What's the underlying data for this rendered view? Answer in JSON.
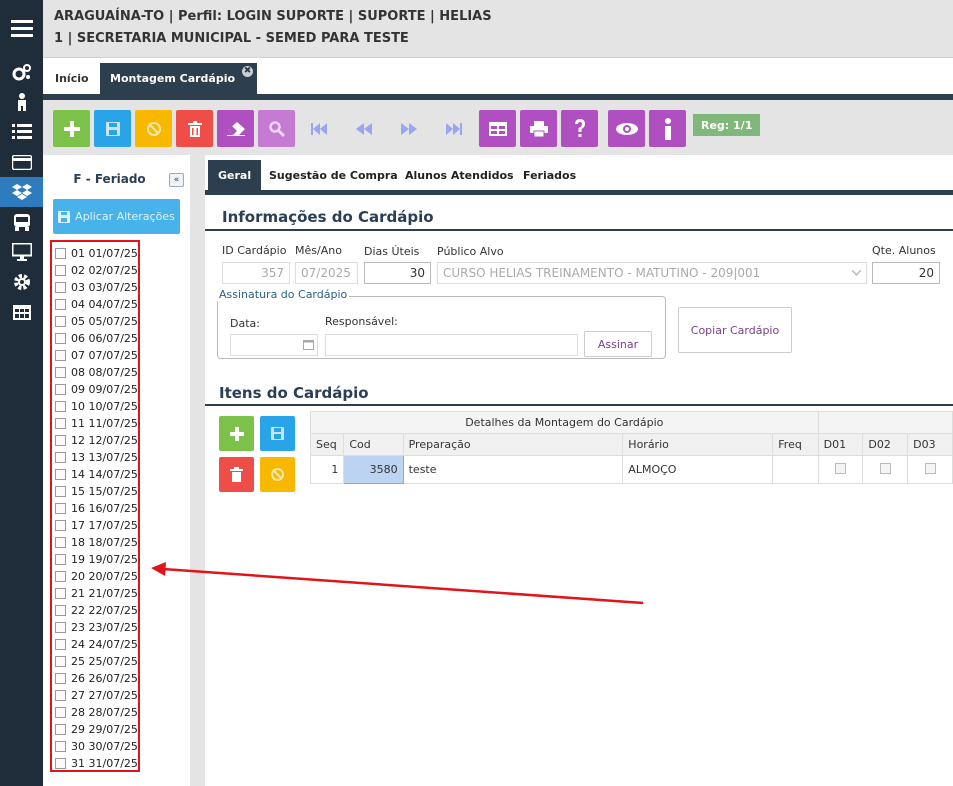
{
  "header": {
    "line1": "ARAGUAÍNA-TO | Perfil: LOGIN SUPORTE | SUPORTE | HELIAS",
    "line2": "1 | SECRETARIA MUNICIPAL - SEMED PARA TESTE"
  },
  "sidebar_icons": [
    "menu-icon",
    "cogs-icon",
    "person-icon",
    "list-icon",
    "credit-card-icon",
    "dropbox-icon",
    "bus-icon",
    "desktop-icon",
    "gear-icon",
    "table-icon"
  ],
  "tabs": [
    {
      "label": "Início"
    },
    {
      "label": "Montagem Cardápio",
      "close": "✖"
    }
  ],
  "toolbar": {
    "reg_label": "Reg: 1/1"
  },
  "left_panel": {
    "title": "F - Feriado",
    "collapse": "«",
    "apply_label": "Aplicar Alterações",
    "days": [
      "01 01/07/25",
      "02 02/07/25",
      "03 03/07/25",
      "04 04/07/25",
      "05 05/07/25",
      "06 06/07/25",
      "07 07/07/25",
      "08 08/07/25",
      "09 09/07/25",
      "10 10/07/25",
      "11 11/07/25",
      "12 12/07/25",
      "13 13/07/25",
      "14 14/07/25",
      "15 15/07/25",
      "16 16/07/25",
      "17 17/07/25",
      "18 18/07/25",
      "19 19/07/25",
      "20 20/07/25",
      "21 21/07/25",
      "22 22/07/25",
      "23 23/07/25",
      "24 24/07/25",
      "25 25/07/25",
      "26 26/07/25",
      "27 27/07/25",
      "28 28/07/25",
      "29 29/07/25",
      "30 30/07/25",
      "31 31/07/25"
    ]
  },
  "subtabs": [
    "Geral",
    "Sugestão de Compra",
    "Alunos Atendidos",
    "Feriados"
  ],
  "info": {
    "section_title": "Informações do Cardápio",
    "id_label": "ID Cardápio",
    "id_value": "357",
    "mes_label": "Mês/Ano",
    "mes_value": "07/2025",
    "dias_label": "Dias Úteis",
    "dias_value": "30",
    "publico_label": "Público Alvo",
    "publico_value": "CURSO HELIAS TREINAMENTO - MATUTINO - 209|001",
    "qte_label": "Qte. Alunos",
    "qte_value": "20",
    "assinatura_legend": "Assinatura do Cardápio",
    "data_label": "Data:",
    "responsavel_label": "Responsável:",
    "assinar_label": "Assinar",
    "copiar_label": "Copiar Cardápio"
  },
  "itens": {
    "section_title": "Itens do Cardápio",
    "group_header": "Detalhes da Montagem do Cardápio",
    "columns": [
      "Seq",
      "Cod",
      "Preparação",
      "Horário",
      "Freq",
      "D01",
      "D02",
      "D03"
    ],
    "row": {
      "seq": "1",
      "cod": "3580",
      "preparacao": "teste",
      "horario": "ALMOÇO",
      "freq": ""
    }
  },
  "colors": {
    "green": "#7cc14a",
    "blue": "#29a4e8",
    "yellow": "#f9b800",
    "red": "#ef4d48",
    "purple": "#b050c0",
    "sidebar": "#1f2d3a",
    "accent": "#2d3e4e",
    "annotation": "#e0151b"
  }
}
